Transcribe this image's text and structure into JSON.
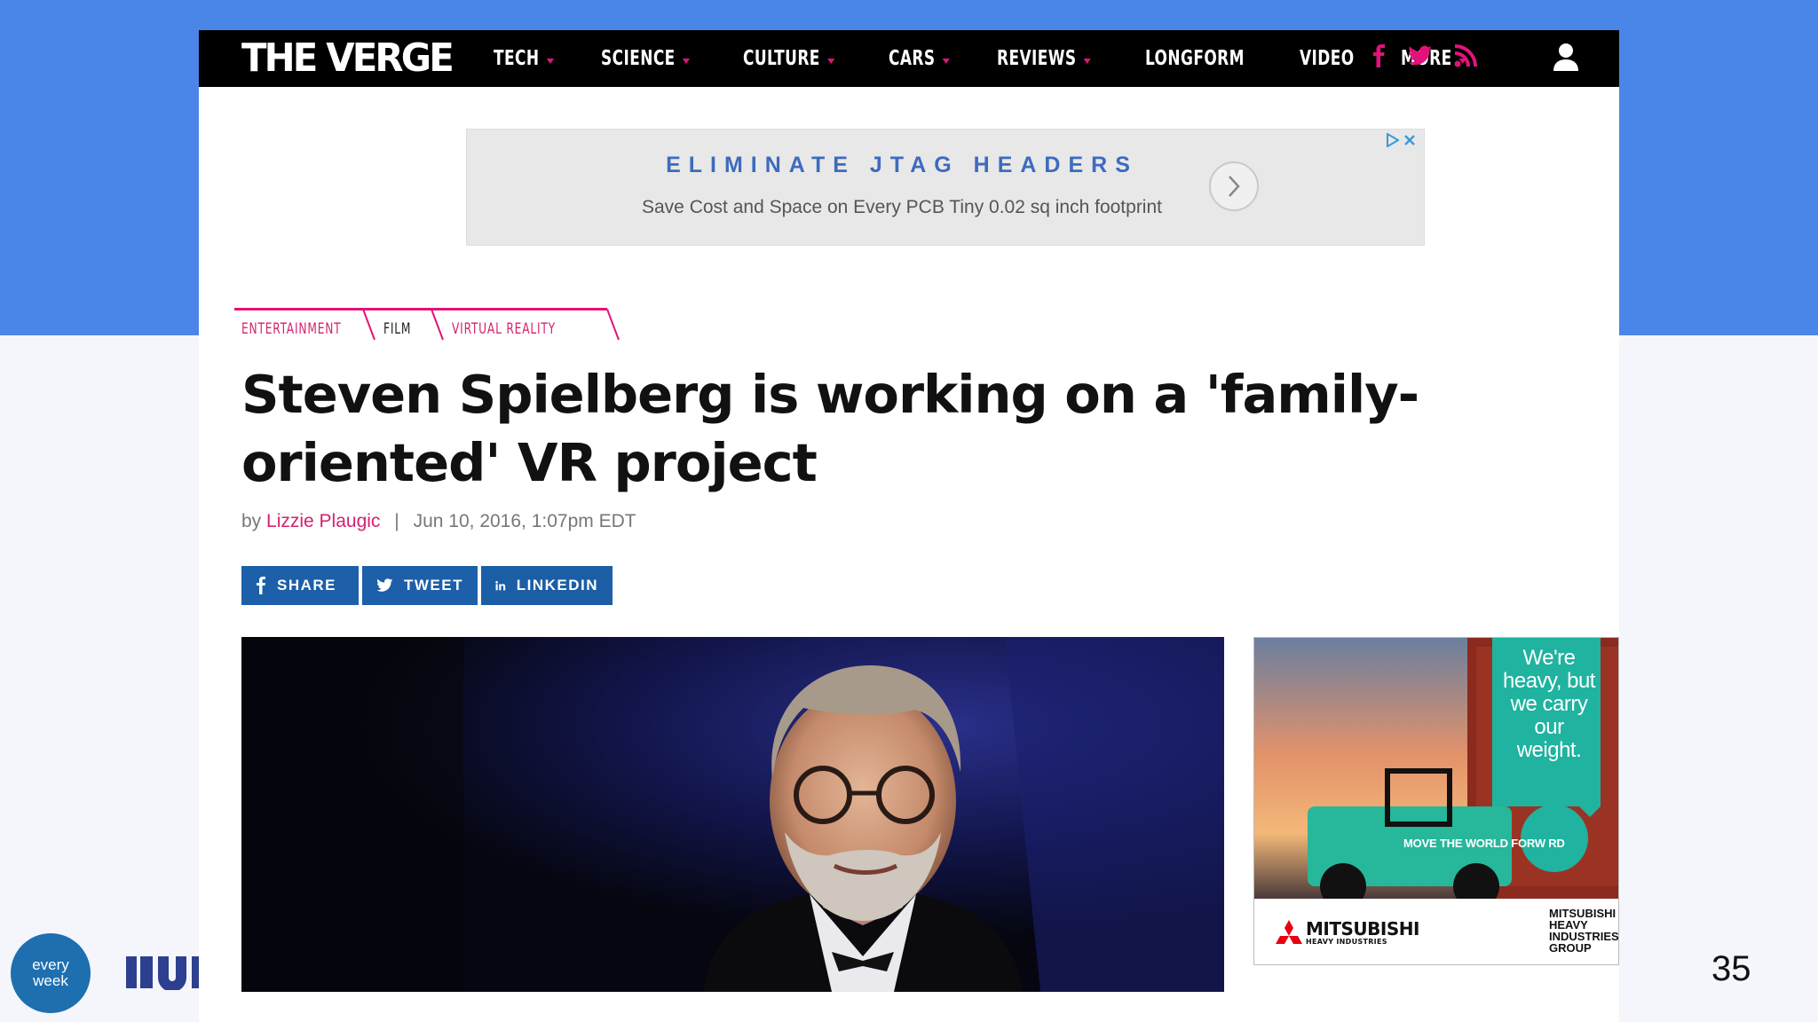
{
  "nav": {
    "logo": "THE VERGE",
    "items": [
      {
        "label": "TECH",
        "has_dropdown": true
      },
      {
        "label": "SCIENCE",
        "has_dropdown": true
      },
      {
        "label": "CULTURE",
        "has_dropdown": true
      },
      {
        "label": "CARS",
        "has_dropdown": true
      },
      {
        "label": "REVIEWS",
        "has_dropdown": true
      },
      {
        "label": "LONGFORM",
        "has_dropdown": false
      },
      {
        "label": "VIDEO",
        "has_dropdown": false
      },
      {
        "label": "MORE",
        "has_dropdown": true
      }
    ],
    "social_icons": [
      "facebook-icon",
      "twitter-icon",
      "rss-icon"
    ],
    "accent_color": "#e2127a"
  },
  "ad_banner": {
    "headline": "ELIMINATE JTAG HEADERS",
    "subtext": "Save Cost and Space on Every PCB Tiny 0.02 sq inch footprint"
  },
  "breadcrumbs": [
    "ENTERTAINMENT",
    "FILM",
    "VIRTUAL REALITY"
  ],
  "article": {
    "title": "Steven Spielberg is working on a 'family-oriented' VR project",
    "by": "by",
    "author": "Lizzie Plaugic",
    "date": "Jun 10, 2016, 1:07pm EDT"
  },
  "share": {
    "share_label": "SHARE",
    "tweet_label": "TWEET",
    "linkedin_label": "LINKEDIN"
  },
  "side_ad": {
    "tagline": "We're heavy, but we carry our weight.",
    "slogan": "MOVE THE WORLD FORW RD",
    "brand": "MITSUBISHI",
    "brand_sub": "HEAVY INDUSTRIES",
    "group": "MITSUBISHI HEAVY INDUSTRIES GROUP"
  },
  "slide": {
    "footer_logo": "every week",
    "page_number": "35"
  }
}
